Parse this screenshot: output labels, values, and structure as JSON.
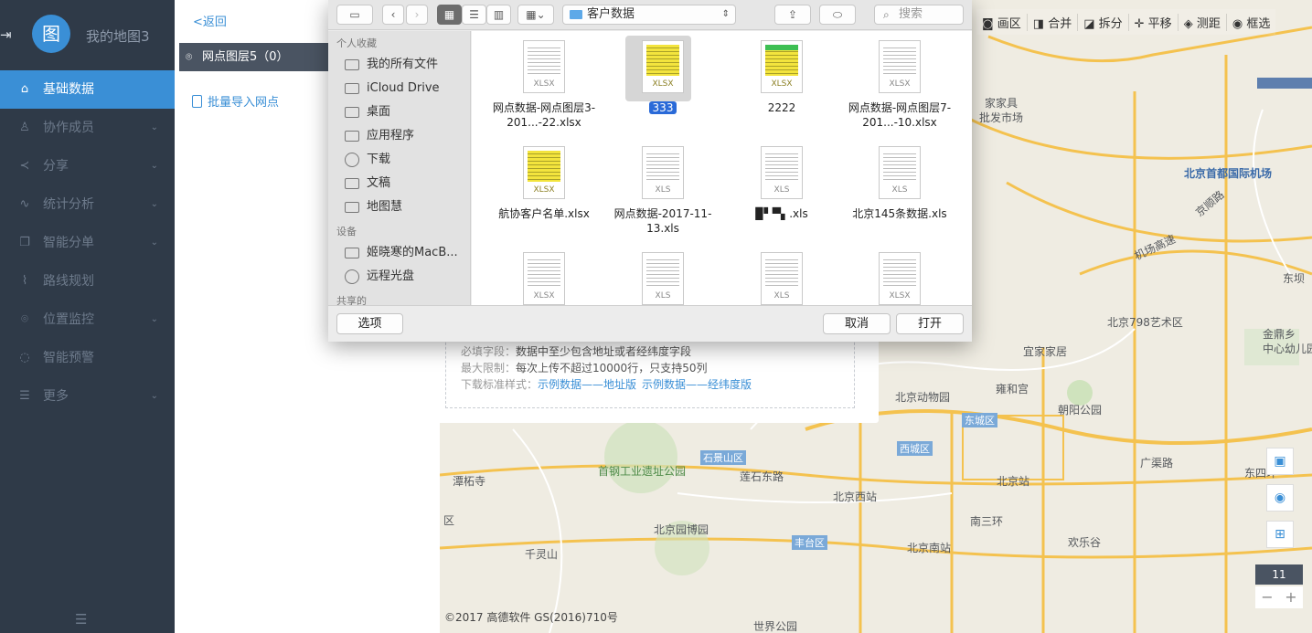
{
  "sidebar": {
    "map_name": "我的地图3",
    "logo_glyph": "图",
    "items": [
      {
        "label": "基础数据",
        "icon": "home-icon",
        "active": true,
        "chevron": false
      },
      {
        "label": "协作成员",
        "icon": "users-icon",
        "chevron": true
      },
      {
        "label": "分享",
        "icon": "share-icon",
        "chevron": true
      },
      {
        "label": "统计分析",
        "icon": "chart-icon",
        "chevron": true
      },
      {
        "label": "智能分单",
        "icon": "split-icon",
        "chevron": true
      },
      {
        "label": "路线规划",
        "icon": "route-icon",
        "chevron": false
      },
      {
        "label": "位置监控",
        "icon": "location-icon",
        "chevron": true
      },
      {
        "label": "智能预警",
        "icon": "alert-icon",
        "chevron": false
      },
      {
        "label": "更多",
        "icon": "list-icon",
        "chevron": true
      }
    ]
  },
  "panel": {
    "back": "<返回",
    "layer_name": "网点图层5（0）",
    "import_label": "批量导入网点"
  },
  "toolbar": [
    "画区",
    "合并",
    "拆分",
    "平移",
    "测距",
    "框选"
  ],
  "map": {
    "labels": {
      "airport": "北京首都国际机场",
      "art798": "北京798艺术区",
      "zoo": "北京动物园",
      "yonghe": "雍和宫",
      "chaoyang_park": "朝阳公园",
      "dongcheng": "东城区",
      "xicheng": "西城区",
      "shijingshan": "石景山区",
      "west_station": "北京西站",
      "beijing_station": "北京站",
      "south_station": "北京南站",
      "fengtai": "丰台区",
      "shougang": "首钢工业遗址公园",
      "lianshi": "莲石东路",
      "tanzhe": "潭柘寺",
      "qianling": "千灵山",
      "garden_expo": "北京园博园",
      "world_park": "世界公园",
      "ikea": "宜家家居",
      "jiaju": "家家具",
      "pifa": "批发市场",
      "airport_hwy": "机场高速",
      "jingshun": "京顺路",
      "dongba": "东坝",
      "dongsihuan": "东四环",
      "jinding": "金鼎乡",
      "kinder": "中心幼儿园",
      "happy_valley": "欢乐谷",
      "nansanhuan": "南三环",
      "guangqu": "广渠路",
      "qu": "区"
    },
    "zoom_level": "11",
    "zoom_minus": "−",
    "zoom_plus": "+",
    "copyright": "©2017 高德软件 GS(2016)710号"
  },
  "import_card": {
    "required_key": "必填字段：",
    "required_val": "数据中至少包含地址或者经纬度字段",
    "limit_key": "最大限制：",
    "limit_val": "每次上传不超过10000行，只支持50列",
    "download_key": "下载标准样式：",
    "link_address": "示例数据——地址版",
    "link_latlng": "示例数据——经纬度版"
  },
  "file_dialog": {
    "path": "客户数据",
    "search_placeholder": "搜索",
    "sections": {
      "favorites": "个人收藏",
      "devices": "设备",
      "shared": "共享的"
    },
    "favorites": [
      {
        "label": "我的所有文件",
        "icon": "all-files-icon"
      },
      {
        "label": "iCloud Drive",
        "icon": "cloud-icon"
      },
      {
        "label": "桌面",
        "icon": "desktop-icon"
      },
      {
        "label": "应用程序",
        "icon": "apps-icon"
      },
      {
        "label": "下载",
        "icon": "download-icon"
      },
      {
        "label": "文稿",
        "icon": "documents-icon"
      },
      {
        "label": "地图慧",
        "icon": "folder-icon"
      }
    ],
    "devices": [
      {
        "label": "姬晓寒的MacB...",
        "icon": "laptop-icon"
      },
      {
        "label": "远程光盘",
        "icon": "disc-icon"
      }
    ],
    "files": [
      {
        "name": "网点数据-网点图层3-201...-22.xlsx",
        "ext": "XLSX",
        "style": "plain",
        "selected": false
      },
      {
        "name": "333",
        "ext": "XLSX",
        "style": "yellow",
        "selected": true
      },
      {
        "name": "2222",
        "ext": "XLSX",
        "style": "ygreen",
        "selected": false
      },
      {
        "name": "网点数据-网点图层7-201...-10.xlsx",
        "ext": "XLSX",
        "style": "plain",
        "selected": false
      },
      {
        "name": "航协客户名单.xlsx",
        "ext": "XLSX",
        "style": "yellow",
        "selected": false
      },
      {
        "name": "网点数据-2017-11-13.xls",
        "ext": "XLS",
        "style": "plain",
        "selected": false
      },
      {
        "name": "▉▘▀▖.xls",
        "ext": "XLS",
        "style": "plain",
        "selected": false
      },
      {
        "name": "北京145条数据.xls",
        "ext": "XLS",
        "style": "plain",
        "selected": false
      },
      {
        "name": "",
        "ext": "XLSX",
        "style": "plain",
        "selected": false
      },
      {
        "name": "",
        "ext": "XLS",
        "style": "plain",
        "selected": false
      },
      {
        "name": "",
        "ext": "XLS",
        "style": "plain",
        "selected": false
      },
      {
        "name": "",
        "ext": "XLSX",
        "style": "plain",
        "selected": false
      }
    ],
    "options_button": "选项",
    "cancel_button": "取消",
    "open_button": "打开"
  }
}
